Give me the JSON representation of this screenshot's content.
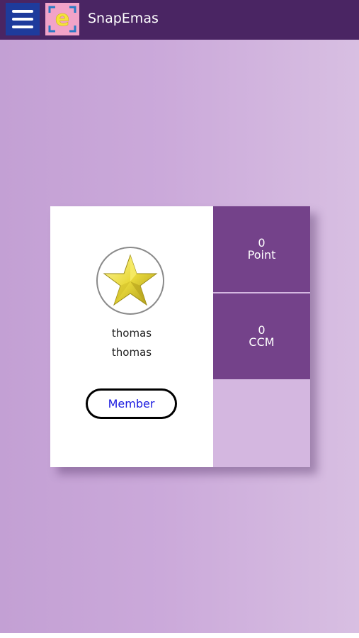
{
  "header": {
    "title": "SnapEmas",
    "menu_icon": "hamburger-menu-icon",
    "logo_letter": "e",
    "bg_color": "#4a2563"
  },
  "profile": {
    "avatar_icon": "gold-star-icon",
    "first_name": "thomas",
    "last_name": "thomas",
    "membership_label": "Member"
  },
  "stats": [
    {
      "value": "0",
      "label": "Point"
    },
    {
      "value": "0",
      "label": "CCM"
    }
  ],
  "colors": {
    "accent": "#74428a",
    "background_left": "#c3a0d4",
    "background_right": "#d8bfe2",
    "member_text": "#1a1ae0"
  }
}
